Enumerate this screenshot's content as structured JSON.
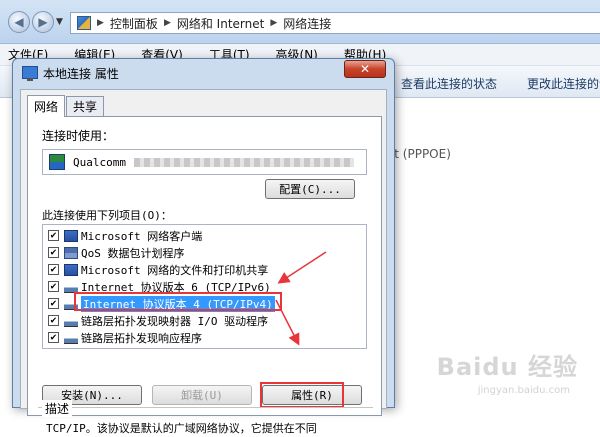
{
  "explorer": {
    "breadcrumbs": [
      "控制面板",
      "网络和 Internet",
      "网络连接"
    ],
    "menu": [
      "文件(F)",
      "编辑(E)",
      "查看(V)",
      "工具(T)",
      "高级(N)",
      "帮助(H)"
    ],
    "toolbar": [
      "查看此连接的状态",
      "更改此连接的设置"
    ],
    "content_partial": "ort (PPPOE)"
  },
  "dialog": {
    "title": "本地连接 属性",
    "close_glyph": "✕",
    "tabs": [
      "网络",
      "共享"
    ],
    "connect_using_label": "连接时使用：",
    "adapter_name": "Qualcomm",
    "configure_button": "配置(C)...",
    "items_label": "此连接使用下列项目(O)：",
    "items": [
      {
        "label": "Microsoft 网络客户端",
        "checked": true,
        "icon": "network-client-icon"
      },
      {
        "label": "QoS 数据包计划程序",
        "checked": true,
        "icon": "scheduler-icon"
      },
      {
        "label": "Microsoft 网络的文件和打印机共享",
        "checked": true,
        "icon": "file-share-icon"
      },
      {
        "label": "Internet 协议版本 6 (TCP/IPv6)",
        "checked": true,
        "icon": "protocol-icon"
      },
      {
        "label": "Internet 协议版本 4 (TCP/IPv4)",
        "checked": true,
        "icon": "protocol-icon",
        "selected": true
      },
      {
        "label": "链路层拓扑发现映射器 I/O 驱动程序",
        "checked": true,
        "icon": "protocol-icon"
      },
      {
        "label": "链路层拓扑发现响应程序",
        "checked": true,
        "icon": "protocol-icon"
      }
    ],
    "install_button": "安装(N)...",
    "uninstall_button": "卸载(U)",
    "properties_button": "属性(R)",
    "description_label": "描述",
    "description_text": "TCP/IP。该协议是默认的广域网络协议，它提供在不同"
  },
  "watermark": {
    "main": "Baidu 经验",
    "sub": "jingyan.baidu.com"
  },
  "colors": {
    "annotation_red": "#e8353a",
    "selection_blue": "#3399ff",
    "title_bar": "#cbdcef"
  }
}
